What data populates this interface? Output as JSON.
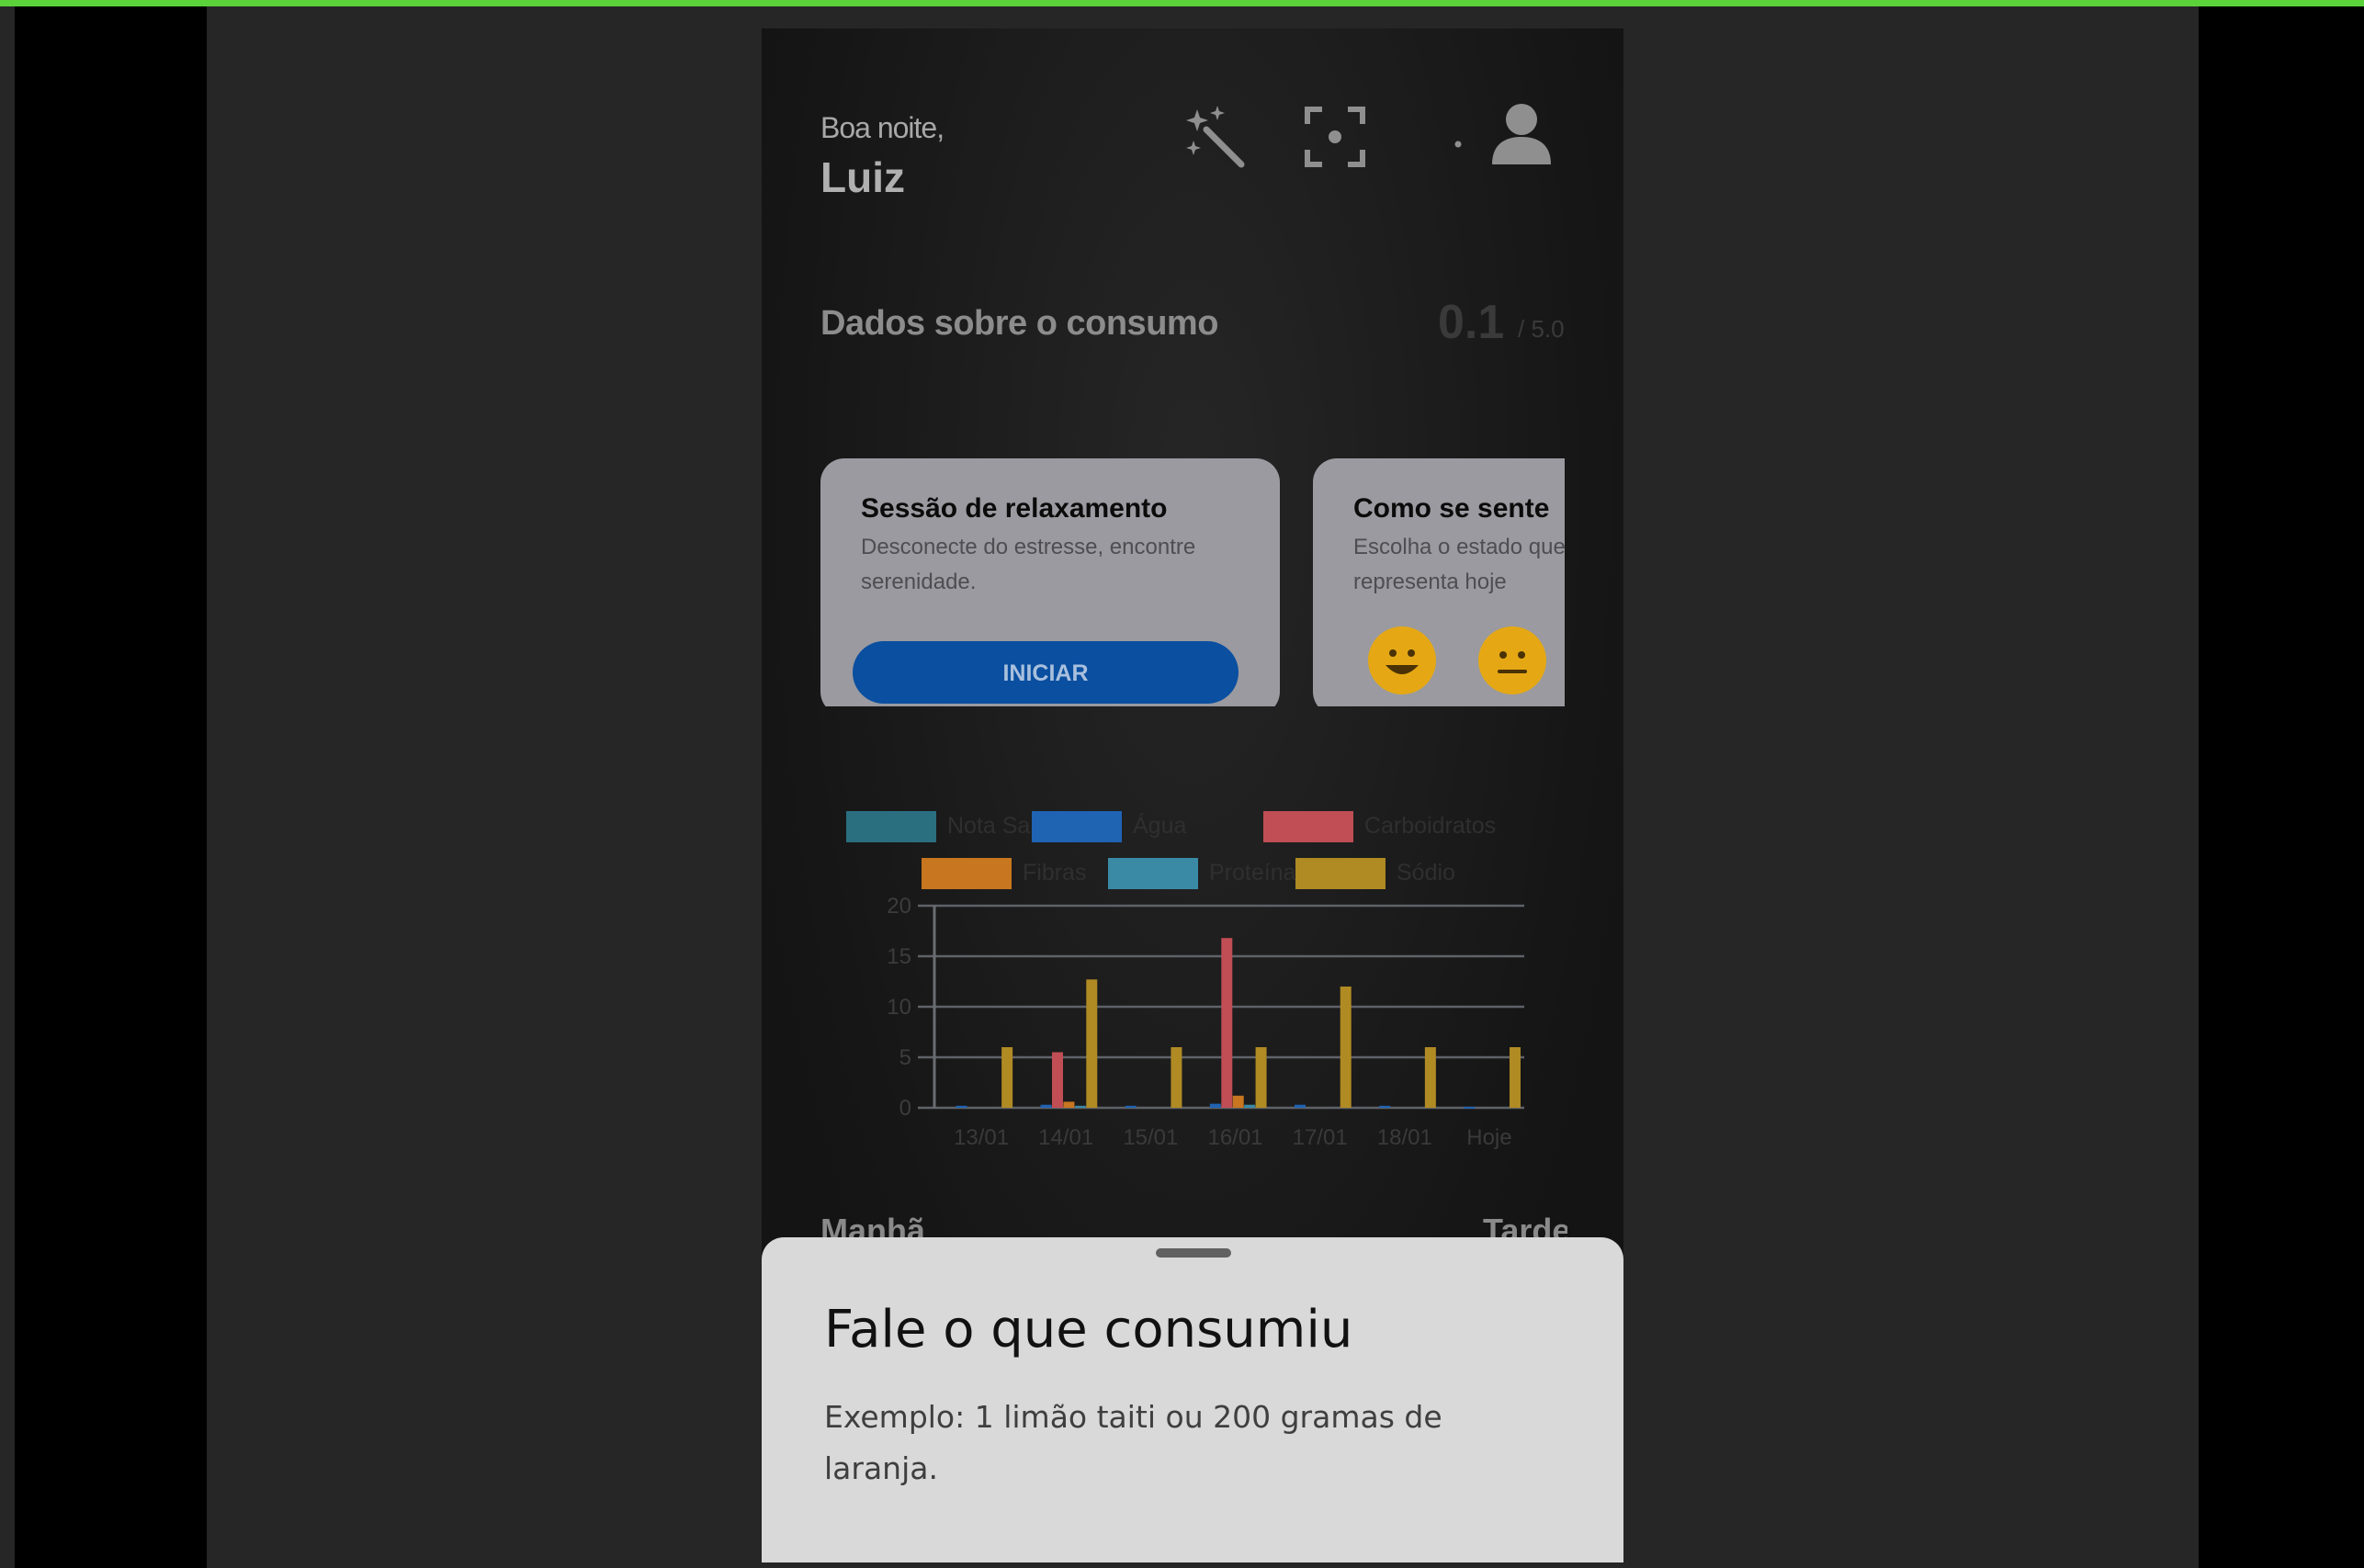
{
  "header": {
    "greeting": "Boa noite,",
    "username": "Luiz",
    "icons": [
      "magic-wand-icon",
      "scan-icon",
      "user-icon"
    ]
  },
  "consumption": {
    "title": "Dados sobre o consumo",
    "score": "0.1",
    "score_max": "/ 5.0"
  },
  "cards": {
    "relax": {
      "title": "Sessão de relaxamento",
      "description": "Desconecte do estresse, encontre serenidade.",
      "button": "INICIAR"
    },
    "mood": {
      "title": "Como se sente",
      "description": "Escolha o estado que representa hoje",
      "emojis": [
        "happy-face-icon",
        "neutral-face-icon"
      ]
    }
  },
  "chart_data": {
    "type": "bar",
    "categories": [
      "13/01",
      "14/01",
      "15/01",
      "16/01",
      "17/01",
      "18/01",
      "Hoje"
    ],
    "ylim": [
      0,
      20
    ],
    "yticks": [
      "0",
      "5",
      "10",
      "15",
      "20"
    ],
    "legend_position": "top",
    "grid": true,
    "series": [
      {
        "name": "Nota Saúde",
        "color": "#2a6f80",
        "values": [
          0,
          0,
          0,
          0,
          0,
          0,
          0
        ]
      },
      {
        "name": "Água",
        "color": "#1f63b3",
        "values": [
          0.2,
          0.3,
          0.2,
          0.4,
          0.3,
          0.2,
          0.1
        ]
      },
      {
        "name": "Carboidratos",
        "color": "#c04e54",
        "values": [
          0,
          5.5,
          0,
          16.8,
          0,
          0,
          0
        ]
      },
      {
        "name": "Fibras",
        "color": "#c87620",
        "values": [
          0,
          0.6,
          0,
          1.2,
          0,
          0,
          0
        ]
      },
      {
        "name": "Proteínas",
        "color": "#3a8aa6",
        "values": [
          0,
          0.2,
          0,
          0.3,
          0,
          0,
          0
        ]
      },
      {
        "name": "Sódio",
        "color": "#b08a23",
        "values": [
          6,
          12.7,
          6,
          6,
          12,
          6,
          6
        ]
      }
    ]
  },
  "periods": {
    "left": "Manhã",
    "right": "Tarde"
  },
  "sheet": {
    "title": "Fale o que consumiu",
    "hint": "Exemplo: 1 limão taiti ou 200 gramas de laranja."
  }
}
